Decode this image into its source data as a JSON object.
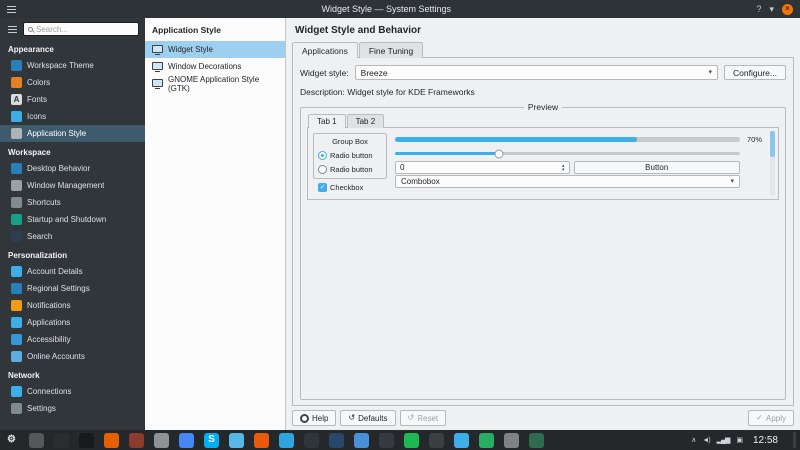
{
  "titlebar": {
    "title": "Widget Style — System Settings",
    "help_glyph": "?",
    "minimize_glyph": "▾",
    "close_glyph": "×"
  },
  "sidebar": {
    "search": {
      "placeholder": "Search..."
    },
    "sections": [
      {
        "label": "Appearance",
        "items": [
          {
            "label": "Workspace Theme",
            "color": "#2980b9",
            "selected": false
          },
          {
            "label": "Colors",
            "color": "#e67e22",
            "selected": false
          },
          {
            "label": "Fonts",
            "color": "#d8dcde",
            "glyph": "A",
            "glyph_color": "#31363b",
            "selected": false
          },
          {
            "label": "Icons",
            "color": "#3daee9",
            "selected": false
          },
          {
            "label": "Application Style",
            "color": "#aeb3b7",
            "selected": true
          }
        ]
      },
      {
        "label": "Workspace",
        "items": [
          {
            "label": "Desktop Behavior",
            "color": "#2980b9",
            "selected": false
          },
          {
            "label": "Window Management",
            "color": "#9aa0a4",
            "selected": false
          },
          {
            "label": "Shortcuts",
            "color": "#7f8c8d",
            "selected": false
          },
          {
            "label": "Startup and Shutdown",
            "color": "#16a085",
            "selected": false
          },
          {
            "label": "Search",
            "color": "#2c3e50",
            "selected": false
          }
        ]
      },
      {
        "label": "Personalization",
        "items": [
          {
            "label": "Account Details",
            "color": "#3daee9",
            "selected": false
          },
          {
            "label": "Regional Settings",
            "color": "#2980b9",
            "selected": false
          },
          {
            "label": "Notifications",
            "color": "#f39c12",
            "selected": false
          },
          {
            "label": "Applications",
            "color": "#3daee9",
            "selected": false
          },
          {
            "label": "Accessibility",
            "color": "#3498db",
            "selected": false
          },
          {
            "label": "Online Accounts",
            "color": "#5dade2",
            "selected": false
          }
        ]
      },
      {
        "label": "Network",
        "items": [
          {
            "label": "Connections",
            "color": "#3daee9",
            "selected": false
          },
          {
            "label": "Settings",
            "color": "#7f8c8d",
            "selected": false
          }
        ]
      }
    ]
  },
  "subsidebar": {
    "title": "Application Style",
    "items": [
      {
        "label": "Widget Style",
        "selected": true
      },
      {
        "label": "Window Decorations",
        "selected": false
      },
      {
        "label": "GNOME Application Style (GTK)",
        "selected": false
      }
    ]
  },
  "main": {
    "title": "Widget Style and Behavior",
    "tabs": [
      {
        "label": "Applications",
        "active": true
      },
      {
        "label": "Fine Tuning",
        "active": false
      }
    ],
    "widget_style_label": "Widget style:",
    "widget_style_value": "Breeze",
    "configure_label": "Configure...",
    "description": "Description: Widget style for KDE Frameworks",
    "preview": {
      "title": "Preview",
      "tabs": [
        {
          "label": "Tab 1",
          "active": true
        },
        {
          "label": "Tab 2",
          "active": false
        }
      ],
      "group_box_label": "Group Box",
      "radio_buttons": [
        {
          "label": "Radio button",
          "checked": true
        },
        {
          "label": "Radio button",
          "checked": false
        }
      ],
      "checkbox": {
        "label": "Checkbox",
        "checked": true
      },
      "progress": {
        "value_label": "70%",
        "percent": 70
      },
      "slider_percent": 30,
      "spinbox_value": "0",
      "button_label": "Button",
      "combobox_value": "Combobox"
    },
    "footer": {
      "help_label": "Help",
      "defaults_label": "Defaults",
      "reset_label": "Reset",
      "apply_label": "Apply"
    }
  },
  "taskbar": {
    "clock": "12:58",
    "apps": [
      {
        "name": "application-launcher",
        "color": "transparent",
        "glyph": "⚙",
        "glyph_color": "#dfe3e6"
      },
      {
        "name": "pager",
        "color": "#54585c"
      },
      {
        "name": "app-window-1",
        "color": "#2a2e33"
      },
      {
        "name": "konsole",
        "color": "#17191c"
      },
      {
        "name": "firefox",
        "color": "#e66000"
      },
      {
        "name": "app-window-2",
        "color": "#8e3b2f"
      },
      {
        "name": "gimp",
        "color": "#8d9297"
      },
      {
        "name": "chromium",
        "color": "#4587f3"
      },
      {
        "name": "skype",
        "color": "#00aff0",
        "glyph": "S"
      },
      {
        "name": "app-window-3",
        "color": "#56b8e6"
      },
      {
        "name": "vlc",
        "color": "#e8590c"
      },
      {
        "name": "telegram",
        "color": "#2ca5e0"
      },
      {
        "name": "app-window-4",
        "color": "#30353a"
      },
      {
        "name": "app-window-5",
        "color": "#28486b"
      },
      {
        "name": "app-window-6",
        "color": "#4a90d9"
      },
      {
        "name": "app-window-7",
        "color": "#343a40"
      },
      {
        "name": "spotify",
        "color": "#1db954"
      },
      {
        "name": "app-window-8",
        "color": "#3a3f44"
      },
      {
        "name": "app-window-9",
        "color": "#3daee9"
      },
      {
        "name": "app-window-10",
        "color": "#27ae60"
      },
      {
        "name": "app-window-11",
        "color": "#7d8387"
      },
      {
        "name": "app-window-12",
        "color": "#2f6c4f"
      }
    ],
    "tray": [
      {
        "name": "tray-expander",
        "glyph": "∧"
      },
      {
        "name": "volume",
        "glyph": "◄)"
      },
      {
        "name": "network",
        "glyph": "▂▄▆"
      },
      {
        "name": "clipboard",
        "glyph": "▣"
      }
    ]
  },
  "icons": {
    "dropdown": "▾",
    "spin_up": "▴",
    "spin_down": "▾",
    "check": "✓",
    "undo": "↺",
    "apply_check": "✓"
  },
  "colors": {
    "accent": "#3daee9",
    "titlebar_bg": "#2e3338",
    "sidebar_bg": "#31363b",
    "panel_bg": "#eff0f1",
    "taskbar_bg": "#24282b",
    "sidebar_selection": "#3e5b6e",
    "list_selection": "#9fcfee",
    "close_button": "#f67400"
  }
}
